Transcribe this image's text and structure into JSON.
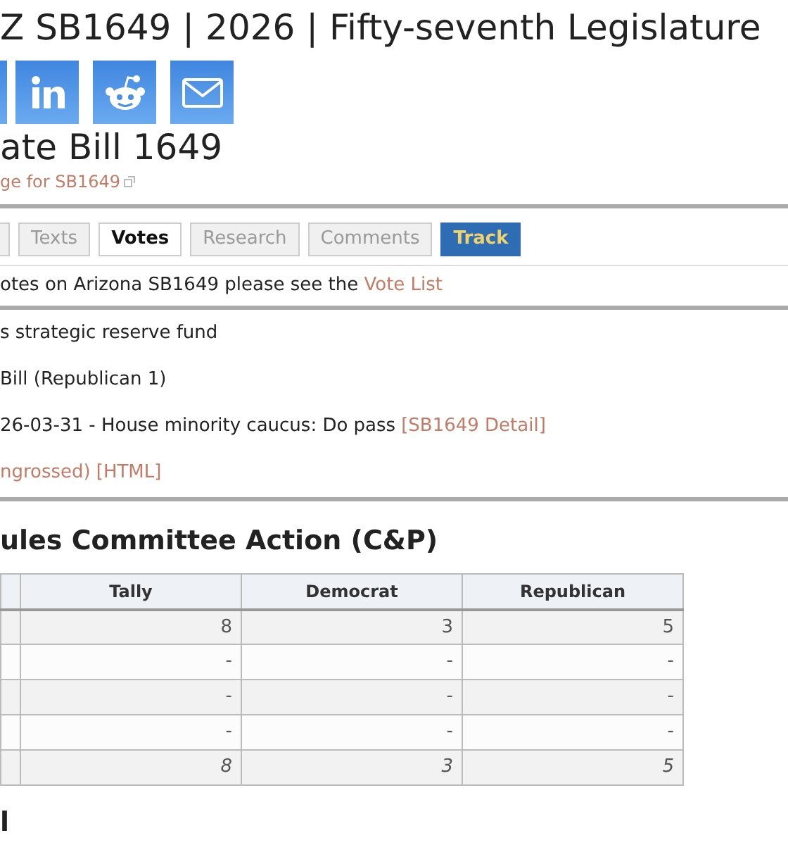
{
  "page_title": "Z SB1649 | 2026 | Fifty-seventh Legislature",
  "share_buttons": [
    {
      "kind": "partial"
    },
    {
      "kind": "linkedin"
    },
    {
      "kind": "reddit"
    },
    {
      "kind": "email"
    }
  ],
  "bill_title": "ate Bill 1649",
  "source_link": "ge for SB1649",
  "tabs": [
    {
      "kind": "partial"
    },
    {
      "label": "Texts",
      "selected": false,
      "kind": "tab"
    },
    {
      "label": "Votes",
      "selected": true,
      "kind": "tab"
    },
    {
      "label": "Research",
      "selected": false,
      "kind": "tab"
    },
    {
      "label": "Comments",
      "selected": false,
      "kind": "tab"
    },
    {
      "label": "Track",
      "kind": "action"
    }
  ],
  "vote_note": {
    "text": "otes on Arizona SB1649 please see the ",
    "link": "Vote List"
  },
  "details": [
    {
      "text": "s strategic reserve fund"
    },
    {
      "text": "Bill (Republican 1)"
    },
    {
      "text": "26-03-31 - House minority caucus: Do pass ",
      "links": [
        "[SB1649 Detail]"
      ]
    },
    {
      "links": [
        "ngrossed)",
        "[HTML]"
      ]
    }
  ],
  "section_heading": "ules Committee Action (C&P)",
  "table": {
    "columns": [
      "Tally",
      "Democrat",
      "Republican"
    ],
    "rows": [
      {
        "kind": "count",
        "cells": [
          "8",
          "3",
          "5"
        ]
      },
      {
        "kind": "count",
        "cells": [
          "-",
          "-",
          "-"
        ]
      },
      {
        "kind": "count",
        "cells": [
          "-",
          "-",
          "-"
        ]
      },
      {
        "kind": "count",
        "cells": [
          "-",
          "-",
          "-"
        ]
      },
      {
        "kind": "total",
        "cells": [
          "8",
          "3",
          "5"
        ]
      }
    ]
  },
  "next_heading": "l"
}
